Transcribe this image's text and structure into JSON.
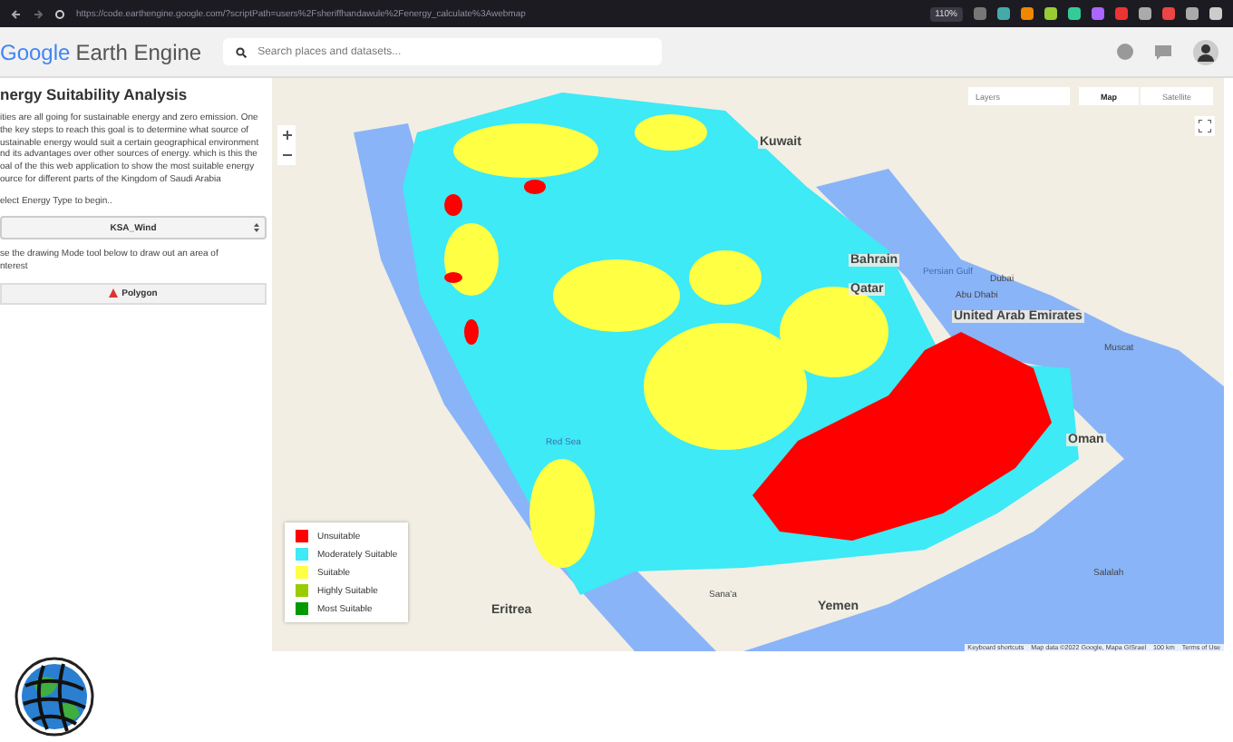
{
  "browser": {
    "url": "https://code.earthengine.google.com/?scriptPath=users%2Fsheriffhandawule%2Fenergy_calculate%3Awebmap",
    "zoom": "110%"
  },
  "header": {
    "logo_google": "Google",
    "logo_product": "Earth Engine",
    "search": {
      "placeholder": "Search places and datasets..."
    }
  },
  "panel": {
    "title": "nergy Suitability Analysis",
    "intro_lines": [
      "ities are all going for sustainable energy and zero emission. One",
      "the key steps to reach this goal is to determine what source of",
      "ustainable energy would suit a certain geographical environment",
      "nd its advantages over other sources of energy. which is this the",
      "oal of the this web application to show the most suitable energy",
      "ource for different parts of the Kingdom of Saudi Arabia"
    ],
    "select_label": "elect Energy Type to begin..",
    "select": {
      "value": "KSA_Wind"
    },
    "draw_lines": [
      "se the drawing Mode tool below to draw out an area of",
      "nterest"
    ],
    "polygon_button": "Polygon"
  },
  "map": {
    "layers_button": "Layers",
    "map_types": [
      {
        "label": "Map",
        "selected": true
      },
      {
        "label": "Satellite",
        "selected": false
      }
    ],
    "places": [
      {
        "label": "Kuwait",
        "kind": "country"
      },
      {
        "label": "Persian Gulf",
        "kind": "water"
      },
      {
        "label": "Bahrain",
        "kind": "country"
      },
      {
        "label": "Qatar",
        "kind": "country"
      },
      {
        "label": "Dubai",
        "kind": "city"
      },
      {
        "label": "Abu Dhabi",
        "kind": "city"
      },
      {
        "label": "United Arab Emirates",
        "kind": "country"
      },
      {
        "label": "Muscat",
        "kind": "city"
      },
      {
        "label": "Oman",
        "kind": "country"
      },
      {
        "label": "Red Sea",
        "kind": "water"
      },
      {
        "label": "Eritrea",
        "kind": "country"
      },
      {
        "label": "Sana'a",
        "kind": "city"
      },
      {
        "label": "Yemen",
        "kind": "country"
      },
      {
        "label": "Salalah",
        "kind": "city"
      }
    ],
    "legend": [
      {
        "label": "Unsuitable",
        "color": "#ff0000"
      },
      {
        "label": "Moderately Suitable",
        "color": "#3deaf5"
      },
      {
        "label": "Suitable",
        "color": "#ffff44"
      },
      {
        "label": "Highly Suitable",
        "color": "#99cc00"
      },
      {
        "label": "Most Suitable",
        "color": "#009900"
      }
    ],
    "footer": [
      "Keyboard shortcuts",
      "Map data ©2022 Google, Mapa GISrael",
      "100 km",
      "Terms of Use"
    ]
  }
}
